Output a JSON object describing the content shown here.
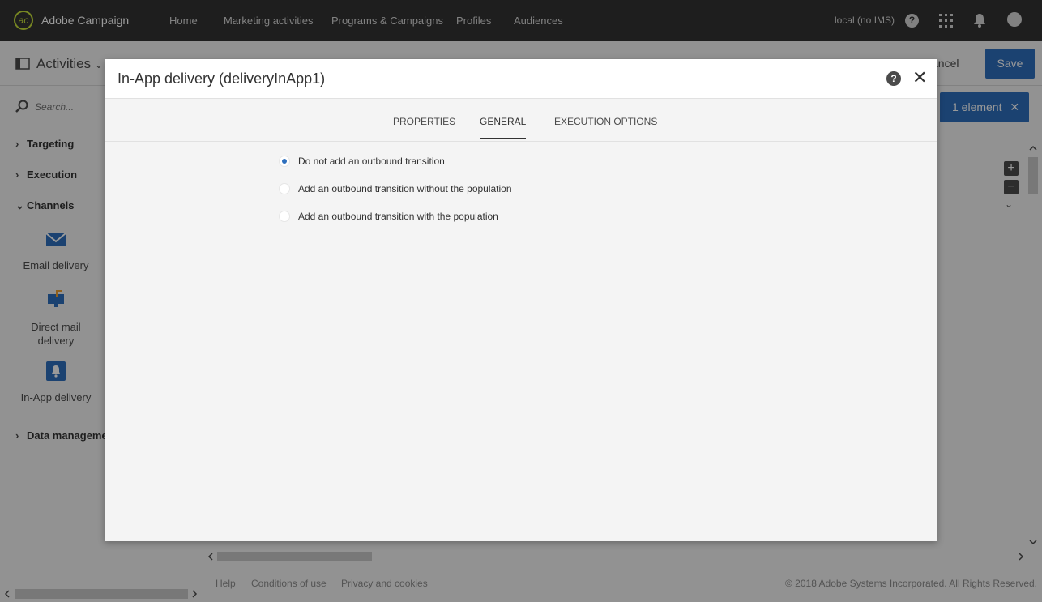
{
  "app": {
    "title": "Adobe Campaign"
  },
  "nav": {
    "items": [
      {
        "label": "Home"
      },
      {
        "label": "Marketing activities"
      },
      {
        "label": "Programs & Campaigns"
      },
      {
        "label": "Profiles"
      },
      {
        "label": "Audiences"
      }
    ],
    "user_label": "local (no IMS)",
    "help_symbol": "?",
    "icons": [
      "help-icon",
      "apps-grid-icon",
      "bell-icon",
      "user-avatar-icon"
    ]
  },
  "toolbar": {
    "activities_label": "Activities",
    "cancel_label": "ancel",
    "save_label": "Save"
  },
  "sidebar": {
    "search_placeholder": "Search...",
    "sections": [
      {
        "label": "Targeting",
        "expanded": false
      },
      {
        "label": "Execution",
        "expanded": false
      },
      {
        "label": "Channels",
        "expanded": true
      },
      {
        "label": "Data managemen",
        "expanded": false
      }
    ],
    "channels": [
      {
        "label": "Email delivery",
        "icon": "envelope-icon"
      },
      {
        "label": "Direct mail delivery",
        "icon": "mailbox-icon"
      },
      {
        "label": "In-App delivery",
        "icon": "bell-icon"
      }
    ]
  },
  "canvas": {
    "selection_chip": "1 element",
    "selection_close": "✕",
    "zoom_in": "+",
    "zoom_out": "−"
  },
  "footer": {
    "links": [
      "Help",
      "Conditions of use",
      "Privacy and cookies"
    ],
    "copyright": "© 2018 Adobe Systems Incorporated. All Rights Reserved."
  },
  "modal": {
    "title": "In-App delivery (deliveryInApp1)",
    "help_symbol": "?",
    "close_symbol": "✕",
    "tabs": [
      {
        "label": "PROPERTIES",
        "active": false
      },
      {
        "label": "GENERAL",
        "active": true
      },
      {
        "label": "EXECUTION OPTIONS",
        "active": false
      }
    ],
    "options": [
      {
        "label": "Do not add an outbound transition",
        "checked": true
      },
      {
        "label": "Add an outbound transition without the population",
        "checked": false
      },
      {
        "label": "Add an outbound transition with the population",
        "checked": false
      }
    ]
  },
  "colors": {
    "topbar": "#323232",
    "accent": "#2d6fbd",
    "logo": "#c6e03a",
    "background": "#f4f4f4"
  }
}
